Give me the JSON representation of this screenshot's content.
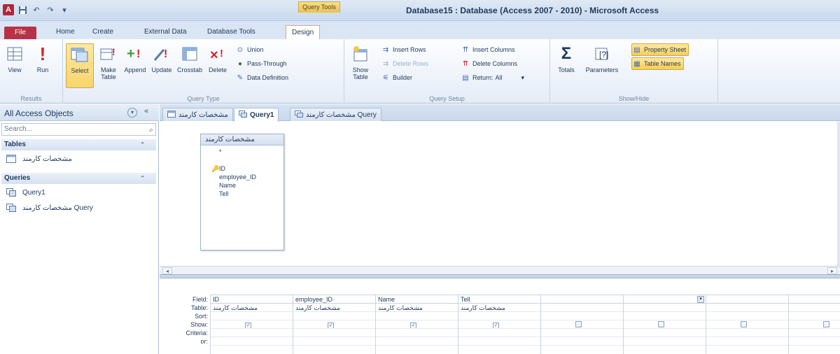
{
  "window": {
    "title": "Database15 : Database (Access 2007 - 2010) - Microsoft Access",
    "context_tab": "Query Tools"
  },
  "quick_access": {
    "app_icon": "A",
    "icons": [
      "save-icon",
      "undo-icon",
      "redo-icon",
      "customize-icon"
    ]
  },
  "tabs": {
    "file": "File",
    "home": "Home",
    "create": "Create",
    "external": "External Data",
    "dbtools": "Database Tools",
    "design": "Design"
  },
  "ribbon": {
    "results": {
      "label": "Results",
      "view": "View",
      "run": "Run"
    },
    "query_type": {
      "label": "Query Type",
      "select": "Select",
      "make_table": "Make Table",
      "append": "Append",
      "update": "Update",
      "crosstab": "Crosstab",
      "delete": "Delete",
      "union": "Union",
      "pass_through": "Pass-Through",
      "data_definition": "Data Definition"
    },
    "query_setup": {
      "label": "Query Setup",
      "show_table": "Show Table",
      "insert_rows": "Insert Rows",
      "delete_rows": "Delete Rows",
      "builder": "Builder",
      "insert_columns": "Insert Columns",
      "delete_columns": "Delete Columns",
      "return_label": "Return:",
      "return_value": "All"
    },
    "show_hide": {
      "label": "Show/Hide",
      "totals": "Totals",
      "parameters": "Parameters",
      "property_sheet": "Property Sheet",
      "table_names": "Table Names"
    }
  },
  "nav": {
    "title": "All Access Objects",
    "search_placeholder": "Search...",
    "tables_group": "Tables",
    "tables": [
      "مشخصات كارمند"
    ],
    "queries_group": "Queries",
    "queries": [
      "Query1",
      "مشخصات كارمند Query"
    ]
  },
  "doc_tabs": [
    "مشخصات كارمند",
    "Query1",
    "مشخصات كارمند Query"
  ],
  "table_box": {
    "title": "مشخصات كارمند",
    "fields": [
      "*",
      "ID",
      "employee_ID",
      "Name",
      "Tell"
    ]
  },
  "qbe": {
    "row_labels": [
      "Field:",
      "Table:",
      "Sort:",
      "Show:",
      "Criteria:",
      "or:"
    ],
    "columns": [
      {
        "field": "ID",
        "table": "مشخصات كارمند",
        "show": true
      },
      {
        "field": "employee_ID",
        "table": "مشخصات كارمند",
        "show": true
      },
      {
        "field": "Name",
        "table": "مشخصات كارمند",
        "show": true
      },
      {
        "field": "Tell",
        "table": "مشخصات كارمند",
        "show": true
      },
      {
        "field": "",
        "table": "",
        "show": false
      },
      {
        "field": "",
        "table": "",
        "show": false
      },
      {
        "field": "",
        "table": "",
        "show": false
      },
      {
        "field": "",
        "table": "",
        "show": false
      }
    ]
  },
  "colors": {
    "file_tab": "#b73246",
    "accent_blue": "#1e395b",
    "highlight_yellow": "#f8d46b"
  }
}
